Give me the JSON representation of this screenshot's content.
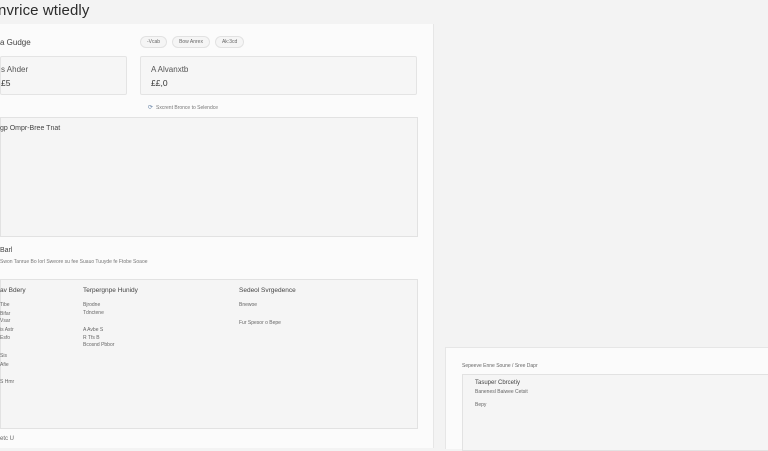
{
  "header": {
    "title": "nvrice wtiedly"
  },
  "summary": {
    "label": "a Gudge"
  },
  "filters": [
    "-Vcab",
    "Bow Anrex",
    "Ak:3cd"
  ],
  "cards": [
    {
      "label": "s Ahder",
      "value": "£5"
    },
    {
      "label": "A Alvanxtb",
      "value": "££,0"
    }
  ],
  "note": {
    "icon": "sync-icon",
    "text": "Sxcrent Bronce to Selendce"
  },
  "chart": {
    "title": "gp Ompr-Bree Tnat"
  },
  "section": {
    "label": "Barl",
    "caption": "Swon Tanrue Bo Iorl Sweore su fee Suauo Tuuyde fe Ftobe Soaoe"
  },
  "details": {
    "columns": [
      {
        "head": "av Bdery",
        "lines": [
          "Tibe",
          "Bifar",
          "Vsar",
          "is Astr",
          "Esfo",
          "Sis",
          "Afie",
          "S Hmr"
        ]
      },
      {
        "head": "Terpergnpe Hunidy",
        "lines": [
          "Bjrodne",
          "Tdnctene",
          "A Avbe S",
          "R Tfs B",
          "Bcosnd Pbbor"
        ]
      },
      {
        "head": "Sedeol Svrgedence",
        "lines": [
          "Bnewoe",
          "Fur Spesor o Bepe"
        ]
      }
    ]
  },
  "footer": {
    "text": "etc  U"
  },
  "side": {
    "title": "Sepeeve Enne Soune  /  Sree Dapr",
    "heading": "Tasuper Cbrcetiy",
    "lines": [
      "Banenesl Baiwee Cetsit",
      "Bepy"
    ]
  }
}
